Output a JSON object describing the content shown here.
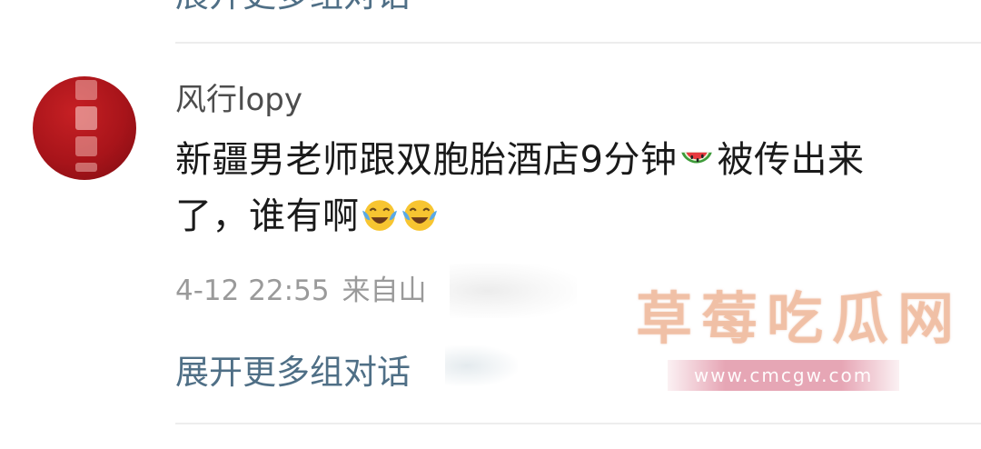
{
  "prev_thread": {
    "expand_label": "展开更多组对话"
  },
  "comment": {
    "username": "风行lopy",
    "text_part1": "新疆男老师跟双胞胎酒店9分钟",
    "emoji_1": "watermelon-emoji",
    "text_part2": "被传出来",
    "text_line2": "了，谁有啊",
    "emoji_2": "laugh-cry-emoji",
    "emoji_3": "laugh-cry-emoji",
    "timestamp": "4-12 22:55",
    "location": "来自山西"
  },
  "thread": {
    "expand_label": "展开更多组对话"
  },
  "watermark": {
    "name": "草莓吃瓜网",
    "url": "www.cmcgw.com"
  },
  "colors": {
    "link": "#4f6f86",
    "username": "#4d4d4d",
    "text": "#1a1a1a",
    "meta": "#9a9a9a",
    "avatar_bg": "#a8141a",
    "divider": "#ededed"
  }
}
